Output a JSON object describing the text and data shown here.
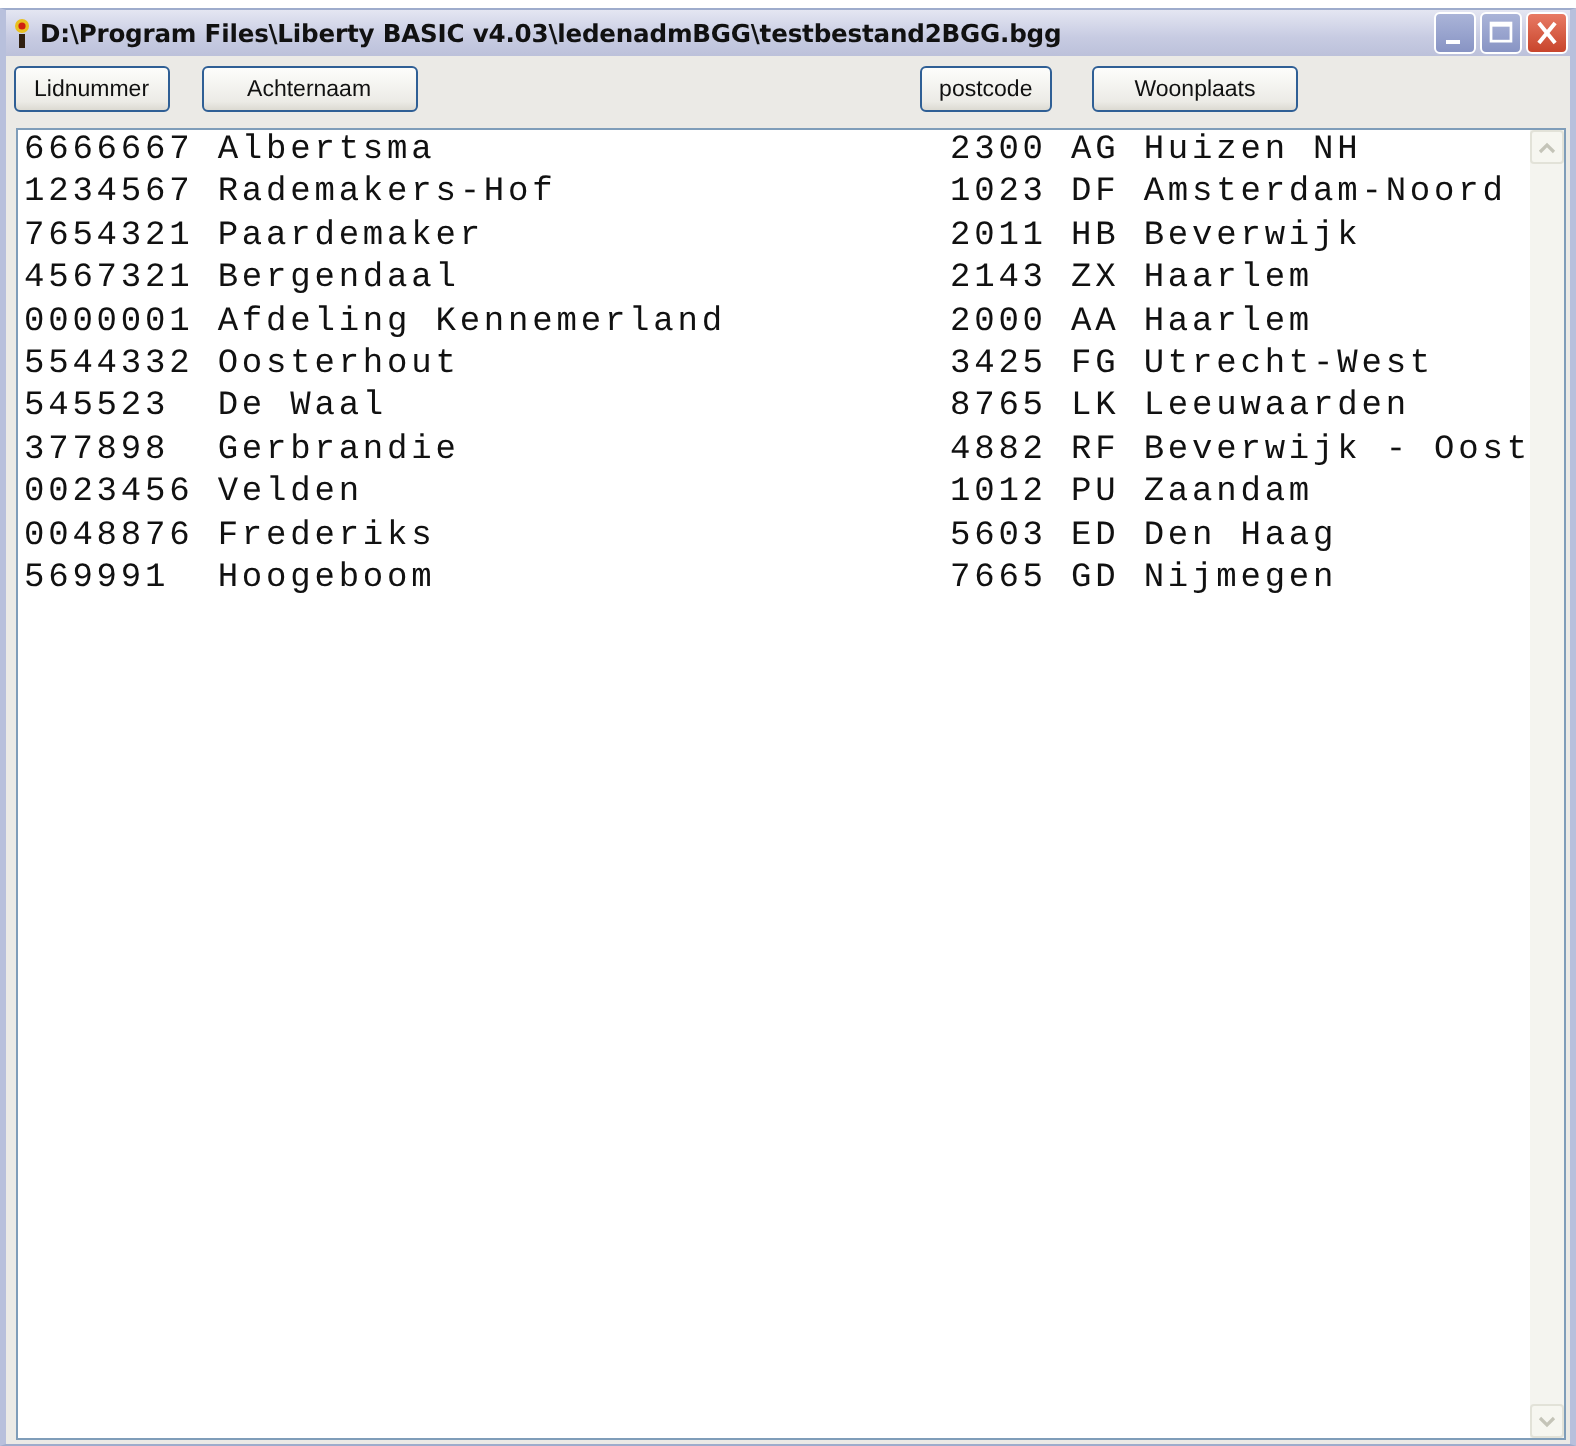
{
  "window": {
    "title": "D:\\Program Files\\Liberty BASIC v4.03\\ledenadmBGG\\testbestand2BGG.bgg"
  },
  "toolbar": {
    "left_buttons": [
      "Lidnummer",
      "Achternaam"
    ],
    "right_buttons": [
      "postcode",
      "Woonplaats"
    ]
  },
  "rows": [
    {
      "member": "6666667 Albertsma",
      "address": "2300 AG Huizen NH"
    },
    {
      "member": "1234567 Rademakers-Hof",
      "address": "1023 DF Amsterdam-Noord"
    },
    {
      "member": "7654321 Paardemaker",
      "address": "2011 HB Beverwijk"
    },
    {
      "member": "4567321 Bergendaal",
      "address": "2143 ZX Haarlem"
    },
    {
      "member": "0000001 Afdeling Kennemerland",
      "address": "2000 AA Haarlem"
    },
    {
      "member": "5544332 Oosterhout",
      "address": "3425 FG Utrecht-West"
    },
    {
      "member": "545523  De Waal",
      "address": "8765 LK Leeuwaarden"
    },
    {
      "member": "377898  Gerbrandie",
      "address": "4882 RF Beverwijk - Oost"
    },
    {
      "member": "0023456 Velden",
      "address": "1012 PU Zaandam"
    },
    {
      "member": "0048876 Frederiks",
      "address": "5603 ED Den Haag"
    },
    {
      "member": "569991  Hoogeboom",
      "address": "7665 GD Nijmegen"
    }
  ]
}
